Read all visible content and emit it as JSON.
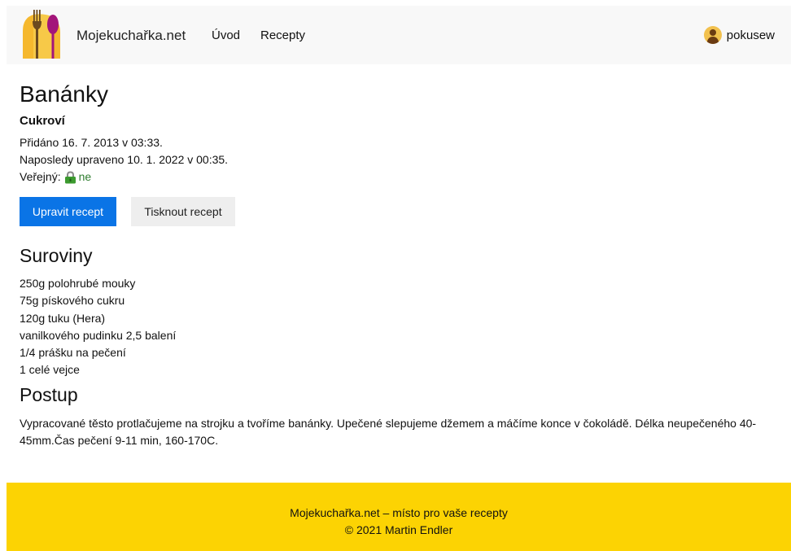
{
  "header": {
    "brand": "Mojekuchařka.net",
    "nav": [
      {
        "label": "Úvod"
      },
      {
        "label": "Recepty"
      }
    ],
    "user": {
      "name": "pokusew"
    }
  },
  "recipe": {
    "title": "Banánky",
    "category": "Cukroví",
    "added": "Přidáno 16. 7. 2013 v 03:33.",
    "updated": "Naposledy upraveno 10. 1. 2022 v 00:35.",
    "public_label": "Veřejný:",
    "public_value": "ne",
    "buttons": {
      "edit": "Upravit recept",
      "print": "Tisknout recept"
    },
    "ingredients_heading": "Suroviny",
    "ingredients": [
      "250g polohrubé mouky",
      "75g pískového cukru",
      "120g tuku (Hera)",
      "vanilkového pudinku 2,5 balení",
      "1/4 prášku na pečení",
      "1 celé vejce"
    ],
    "steps_heading": "Postup",
    "steps": "Vypracované těsto protlačujeme na strojku a tvoříme banánky. Upečené slepujeme džemem a máčíme konce v čokoládě. Délka neupečeného 40-45mm.Čas pečení 9-11 min, 160-170C."
  },
  "footer": {
    "line1": "Mojekuchařka.net – místo pro vaše recepty",
    "line2": "© 2021 Martin Endler"
  },
  "colors": {
    "primary": "#0a74e6",
    "footer": "#fcd303",
    "public_no": "#2f7d2f"
  }
}
